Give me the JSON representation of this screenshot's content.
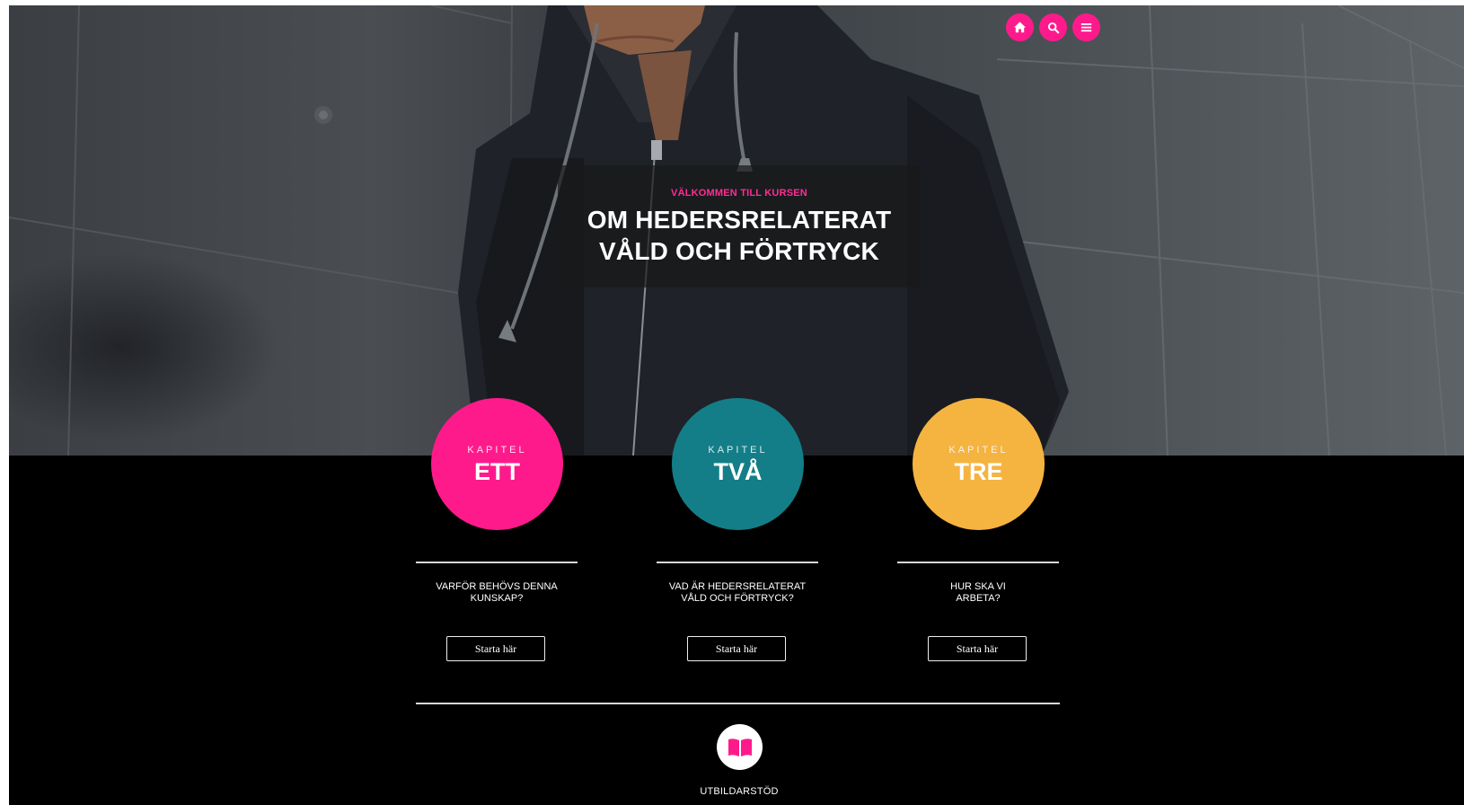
{
  "nav": {
    "icons": [
      "home-icon",
      "search-icon",
      "menu-icon"
    ],
    "accent": "#ff1a8c"
  },
  "hero": {
    "kicker": "VÄLKOMMEN TILL KURSEN",
    "title_line1": "OM HEDERSRELATERAT",
    "title_line2": "VÅLD OCH FÖRTRYCK"
  },
  "chapters": [
    {
      "kicker": "KAPITEL",
      "number": "ETT",
      "color": "#ff1a8c",
      "question": "VARFÖR BEHÖVS DENNA\nKUNSKAP?",
      "button": "Starta här"
    },
    {
      "kicker": "KAPITEL",
      "number": "TVÅ",
      "color": "#137e87",
      "question": "VAD ÄR HEDERSRELATERAT\nVÅLD OCH FÖRTRYCK?",
      "button": "Starta här"
    },
    {
      "kicker": "KAPITEL",
      "number": "TRE",
      "color": "#f5b340",
      "question": "HUR SKA VI\nARBETA?",
      "button": "Starta här"
    }
  ],
  "support": {
    "icon": "book-icon",
    "label": "UTBILDARSTÖD"
  }
}
